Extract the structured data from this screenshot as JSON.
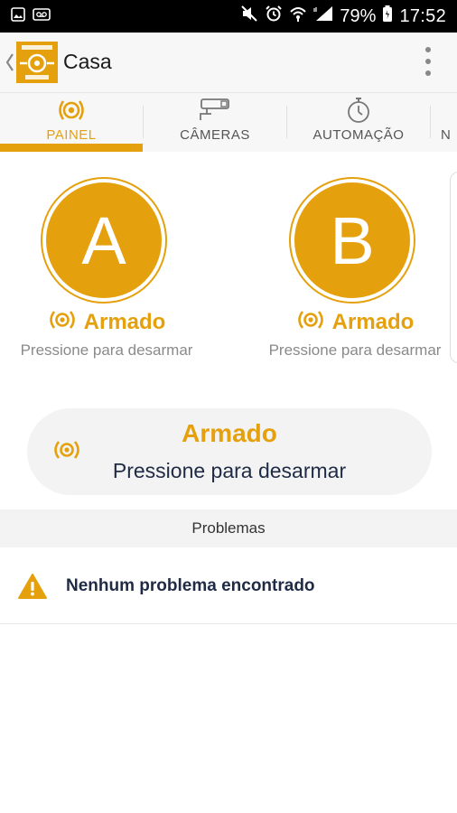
{
  "status_bar": {
    "battery": "79%",
    "time": "17:52"
  },
  "app_bar": {
    "title": "Casa"
  },
  "tabs": [
    {
      "label": "PAINEL",
      "icon": "alarm-icon",
      "active": true
    },
    {
      "label": "CÂMERAS",
      "icon": "camera-icon",
      "active": false
    },
    {
      "label": "AUTOMAÇÃO",
      "icon": "timer-icon",
      "active": false
    },
    {
      "label": "N",
      "icon": "",
      "active": false
    }
  ],
  "partitions": [
    {
      "letter": "A",
      "status": "Armado",
      "hint": "Pressione para desarmar"
    },
    {
      "letter": "B",
      "status": "Armado",
      "hint": "Pressione para desarmar"
    }
  ],
  "global_arm": {
    "status": "Armado",
    "hint": "Pressione para desarmar"
  },
  "problems": {
    "header": "Problemas",
    "items": [
      {
        "text": "Nenhum problema encontrado",
        "icon": "warning-icon"
      }
    ]
  },
  "colors": {
    "accent": "#e5a00d",
    "text_dark": "#1f2a44",
    "status_bar": "#000000"
  }
}
